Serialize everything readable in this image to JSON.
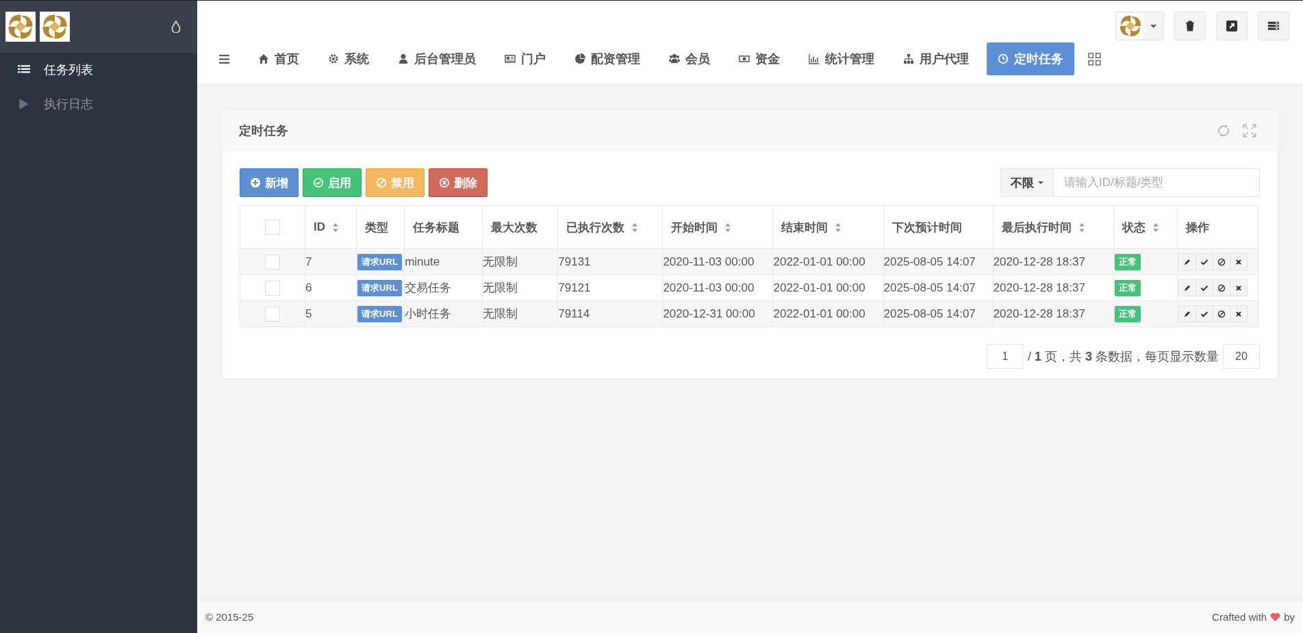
{
  "sidebar": {
    "items": [
      {
        "label": "任务列表",
        "selected": true
      },
      {
        "label": "执行日志",
        "selected": false
      }
    ]
  },
  "nav": {
    "tabs": [
      {
        "label": "首页",
        "selected": false
      },
      {
        "label": "系统",
        "selected": false
      },
      {
        "label": "后台管理员",
        "selected": false
      },
      {
        "label": "门户",
        "selected": false
      },
      {
        "label": "配资管理",
        "selected": false
      },
      {
        "label": "会员",
        "selected": false
      },
      {
        "label": "资金",
        "selected": false
      },
      {
        "label": "统计管理",
        "selected": false
      },
      {
        "label": "用户代理",
        "selected": false
      },
      {
        "label": "定时任务",
        "selected": true
      }
    ]
  },
  "panel": {
    "title": "定时任务",
    "toolbar": [
      {
        "label": "新增",
        "kind": "primary"
      },
      {
        "label": "启用",
        "kind": "success"
      },
      {
        "label": "禁用",
        "kind": "warning"
      },
      {
        "label": "删除",
        "kind": "danger"
      }
    ],
    "search": {
      "filter": "不限",
      "placeholder": "请输入ID/标题/类型"
    },
    "table": {
      "select_all_checked": false,
      "columns": [
        {
          "label": "ID",
          "sortable": true
        },
        {
          "label": "类型",
          "sortable": false
        },
        {
          "label": "任务标题",
          "sortable": false
        },
        {
          "label": "最大次数",
          "sortable": false
        },
        {
          "label": "已执行次数",
          "sortable": true
        },
        {
          "label": "开始时间",
          "sortable": true
        },
        {
          "label": "结束时间",
          "sortable": true
        },
        {
          "label": "下次预计时间",
          "sortable": false
        },
        {
          "label": "最后执行时间",
          "sortable": true
        },
        {
          "label": "状态",
          "sortable": true
        },
        {
          "label": "操作",
          "sortable": false
        }
      ],
      "rows": [
        {
          "checked": false,
          "cells": [
            "7",
            "请求URL",
            "minute",
            "无限制",
            "79131",
            "2020-11-03 00:00",
            "2022-01-01 00:00",
            "2025-08-05 14:07",
            "2020-12-28 18:37",
            "正常"
          ]
        },
        {
          "checked": false,
          "cells": [
            "6",
            "请求URL",
            "交易任务",
            "无限制",
            "79121",
            "2020-11-03 00:00",
            "2022-01-01 00:00",
            "2025-08-05 14:07",
            "2020-12-28 18:37",
            "正常"
          ]
        },
        {
          "checked": false,
          "cells": [
            "5",
            "请求URL",
            "小时任务",
            "无限制",
            "79114",
            "2020-12-31 00:00",
            "2022-01-01 00:00",
            "2025-08-05 14:07",
            "2020-12-28 18:37",
            "正常"
          ]
        }
      ]
    },
    "pagination": {
      "page": "1",
      "summary": "/ **1** 页，共 **3** 条数据，每页显示数量",
      "page_size": "20"
    }
  },
  "footer": {
    "copyright": "© 2015-25",
    "credit_prefix": "Crafted with",
    "credit_suffix": "by"
  }
}
